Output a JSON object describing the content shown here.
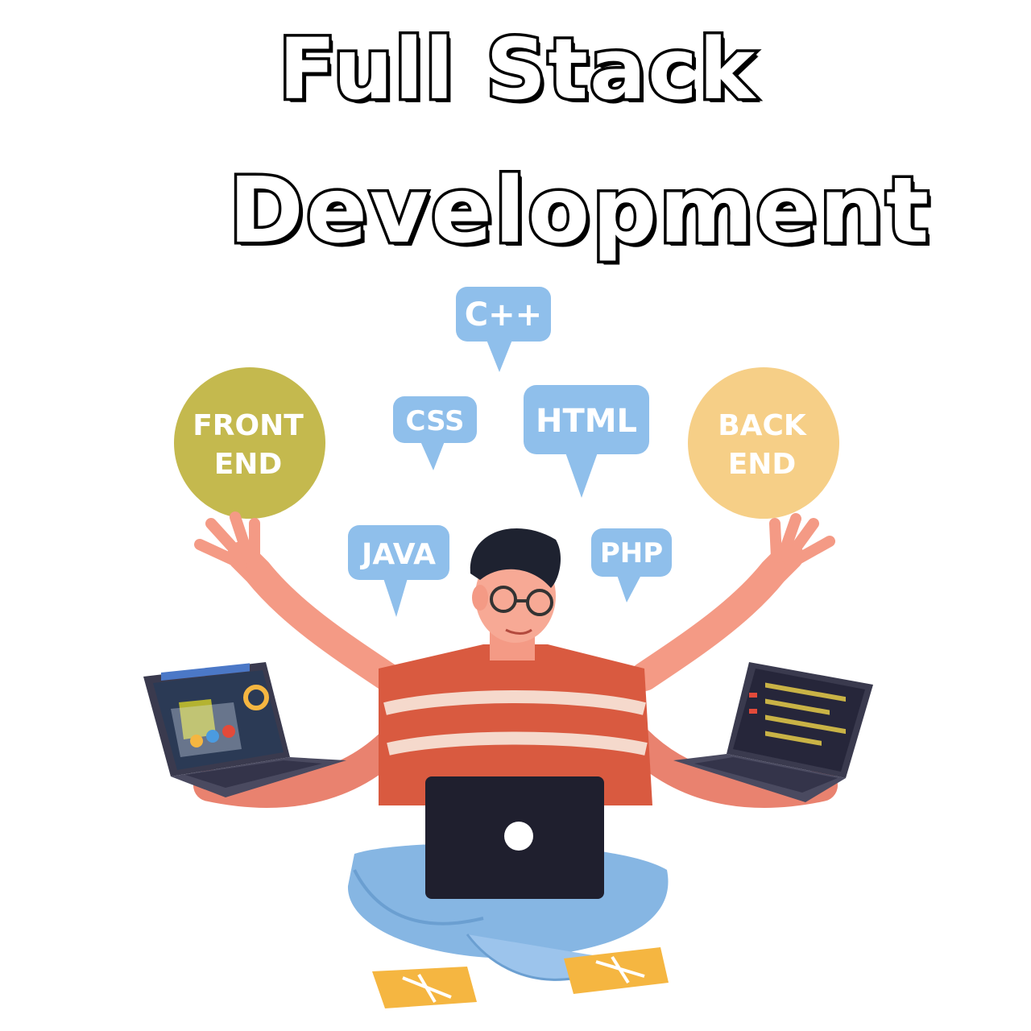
{
  "title": {
    "line1": "Full Stack",
    "line2": "Development"
  },
  "circles": {
    "front": {
      "line1": "FRONT",
      "line2": "END",
      "color": "#c4b94e"
    },
    "back": {
      "line1": "BACK",
      "line2": "END",
      "color": "#f6cf87"
    }
  },
  "bubbles": {
    "cpp": "C++",
    "css": "CSS",
    "html": "HTML",
    "java": "JAVA",
    "php": "PHP",
    "color": "#8fbfeb"
  },
  "colors": {
    "skin": "#f49a85",
    "shirt": "#d95a40",
    "pants": "#86b6e3",
    "laptop": "#1f1f2e",
    "shoes": "#f5b641",
    "hair": "#1e2230"
  }
}
